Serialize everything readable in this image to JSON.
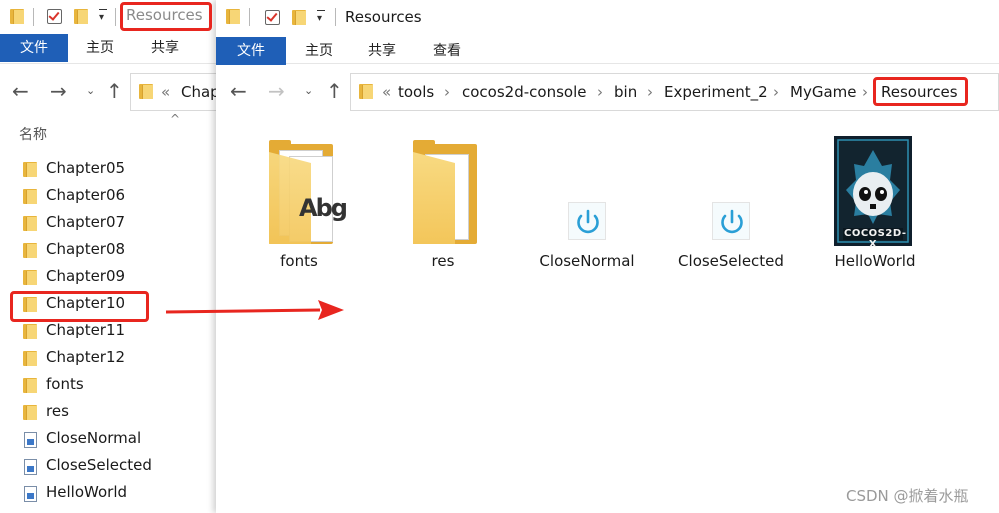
{
  "back_window": {
    "title": "Resources",
    "tabs": [
      "文件",
      "主页",
      "共享"
    ],
    "address_prefix": "«",
    "address_text": "Chap",
    "column_header": "名称",
    "items": [
      {
        "name": "Chapter05",
        "kind": "folder"
      },
      {
        "name": "Chapter06",
        "kind": "folder"
      },
      {
        "name": "Chapter07",
        "kind": "folder"
      },
      {
        "name": "Chapter08",
        "kind": "folder"
      },
      {
        "name": "Chapter09",
        "kind": "folder"
      },
      {
        "name": "Chapter10",
        "kind": "folder"
      },
      {
        "name": "Chapter11",
        "kind": "folder"
      },
      {
        "name": "Chapter12",
        "kind": "folder"
      },
      {
        "name": "fonts",
        "kind": "folder"
      },
      {
        "name": "res",
        "kind": "folder"
      },
      {
        "name": "CloseNormal",
        "kind": "image"
      },
      {
        "name": "CloseSelected",
        "kind": "image"
      },
      {
        "name": "HelloWorld",
        "kind": "image"
      }
    ]
  },
  "front_window": {
    "title": "Resources",
    "tabs": [
      "文件",
      "主页",
      "共享",
      "查看"
    ],
    "breadcrumb_prefix": "«",
    "breadcrumb": [
      "tools",
      "cocos2d-console",
      "bin",
      "Experiment_2",
      "MyGame",
      "Resources"
    ],
    "items": [
      {
        "name": "fonts",
        "kind": "folder-fonts"
      },
      {
        "name": "res",
        "kind": "folder"
      },
      {
        "name": "CloseNormal",
        "kind": "power-icon"
      },
      {
        "name": "CloseSelected",
        "kind": "power-icon"
      },
      {
        "name": "HelloWorld",
        "kind": "cocos-logo"
      }
    ]
  },
  "logo_text": "COCOS2D-X",
  "watermark": "CSDN @掀着水瓶",
  "colors": {
    "file_tab": "#1f5fb7",
    "highlight": "#e8261f",
    "folder": "#f7d676",
    "power": "#2a9fd6"
  }
}
